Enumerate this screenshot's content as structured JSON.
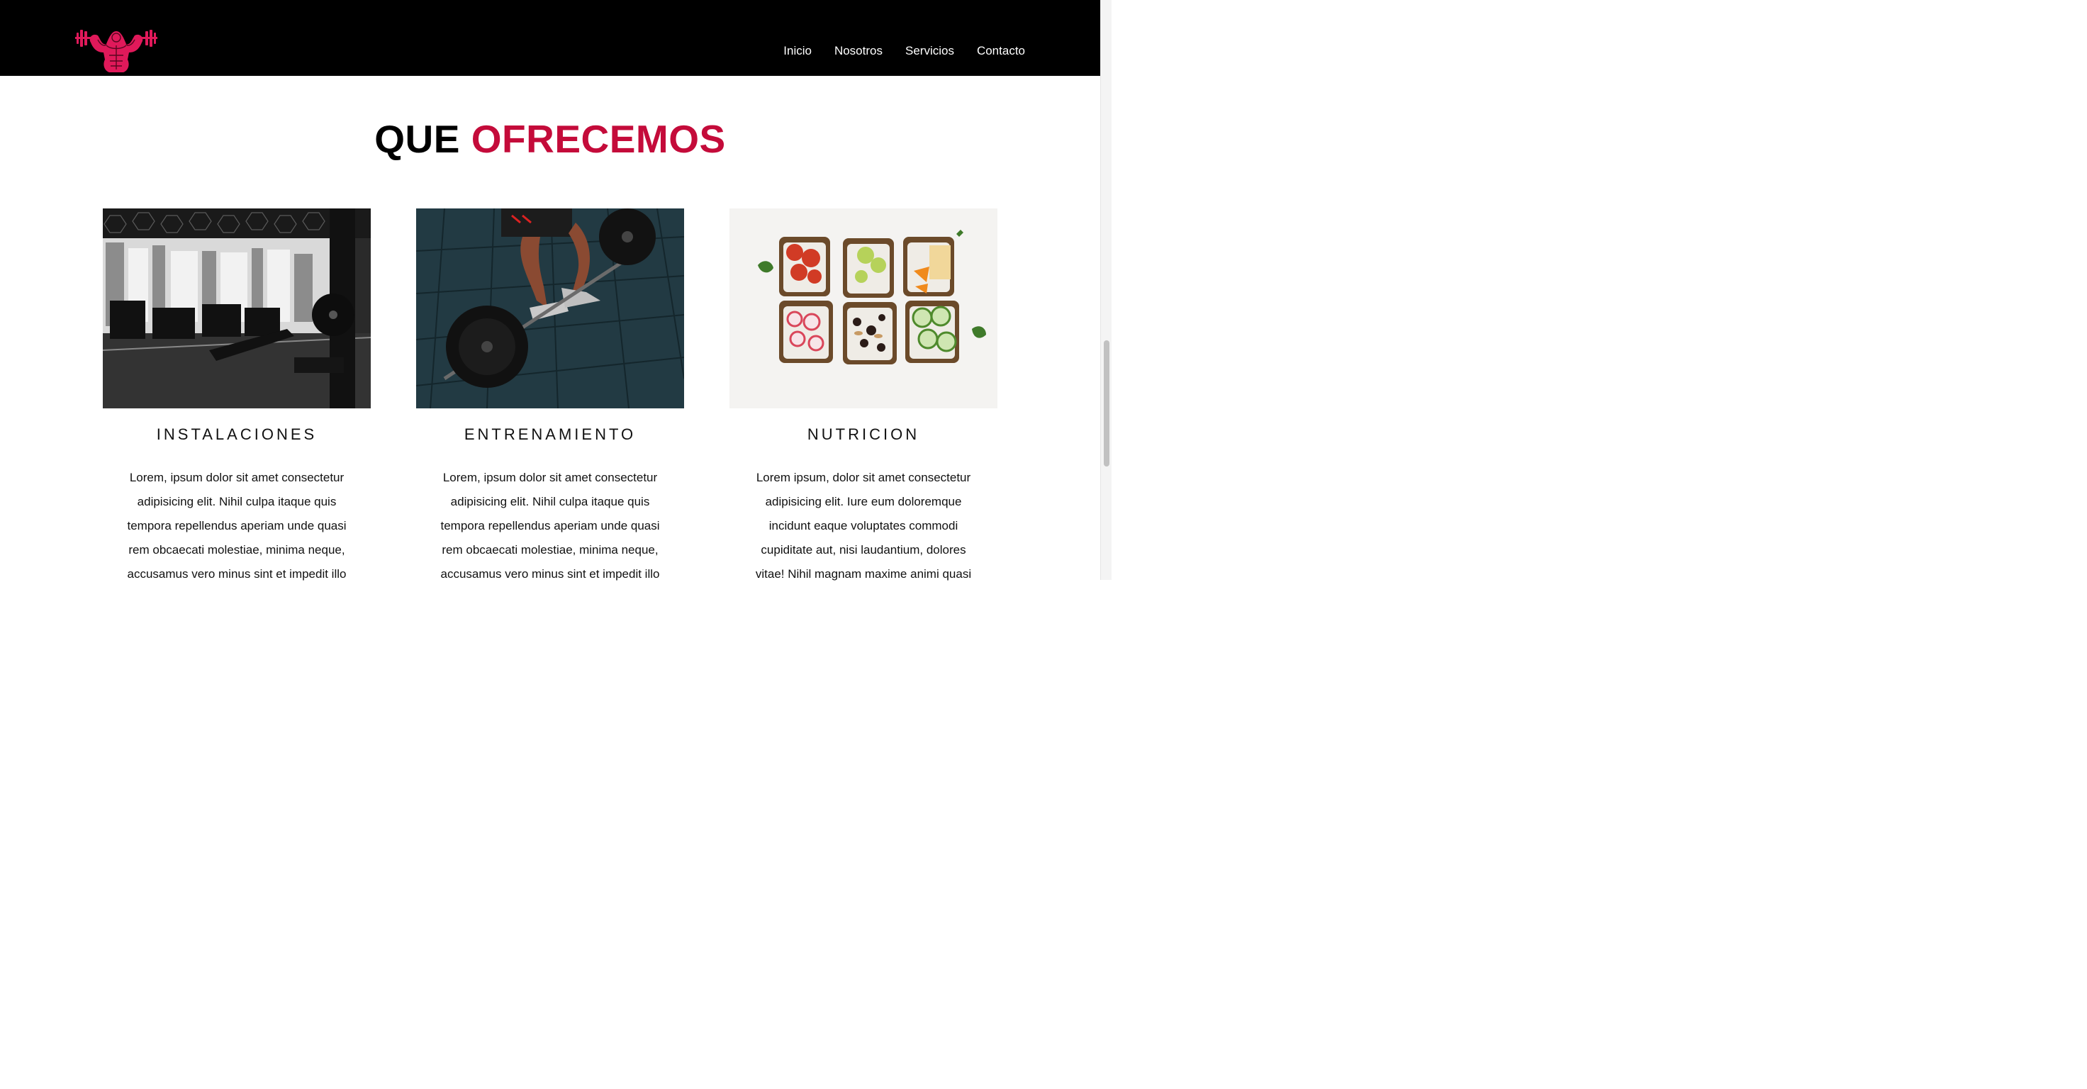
{
  "nav": {
    "logo_icon": "bodybuilder-dumbbells-logo",
    "items": [
      {
        "label": "Inicio"
      },
      {
        "label": "Nosotros"
      },
      {
        "label": "Servicios"
      },
      {
        "label": "Contacto"
      }
    ]
  },
  "section": {
    "title_part1": "QUE",
    "title_part2": "OFRECEMOS",
    "accent_color": "#c40b3a"
  },
  "cards": [
    {
      "image": "gym-interior-photo",
      "title": "INSTALACIONES",
      "text": "Lorem, ipsum dolor sit amet consectetur adipisicing elit. Nihil culpa itaque quis tempora repellendus aperiam unde quasi rem obcaecati molestiae, minima neque, accusamus vero minus sint et impedit illo"
    },
    {
      "image": "deadlift-barbell-photo",
      "title": "ENTRENAMIENTO",
      "text": "Lorem, ipsum dolor sit amet consectetur adipisicing elit. Nihil culpa itaque quis tempora repellendus aperiam unde quasi rem obcaecati molestiae, minima neque, accusamus vero minus sint et impedit illo"
    },
    {
      "image": "healthy-toasts-photo",
      "title": "NUTRICION",
      "text": "Lorem ipsum, dolor sit amet consectetur adipisicing elit. Iure eum doloremque incidunt eaque voluptates commodi cupiditate aut, nisi laudantium, dolores vitae! Nihil magnam maxime animi quasi"
    }
  ]
}
